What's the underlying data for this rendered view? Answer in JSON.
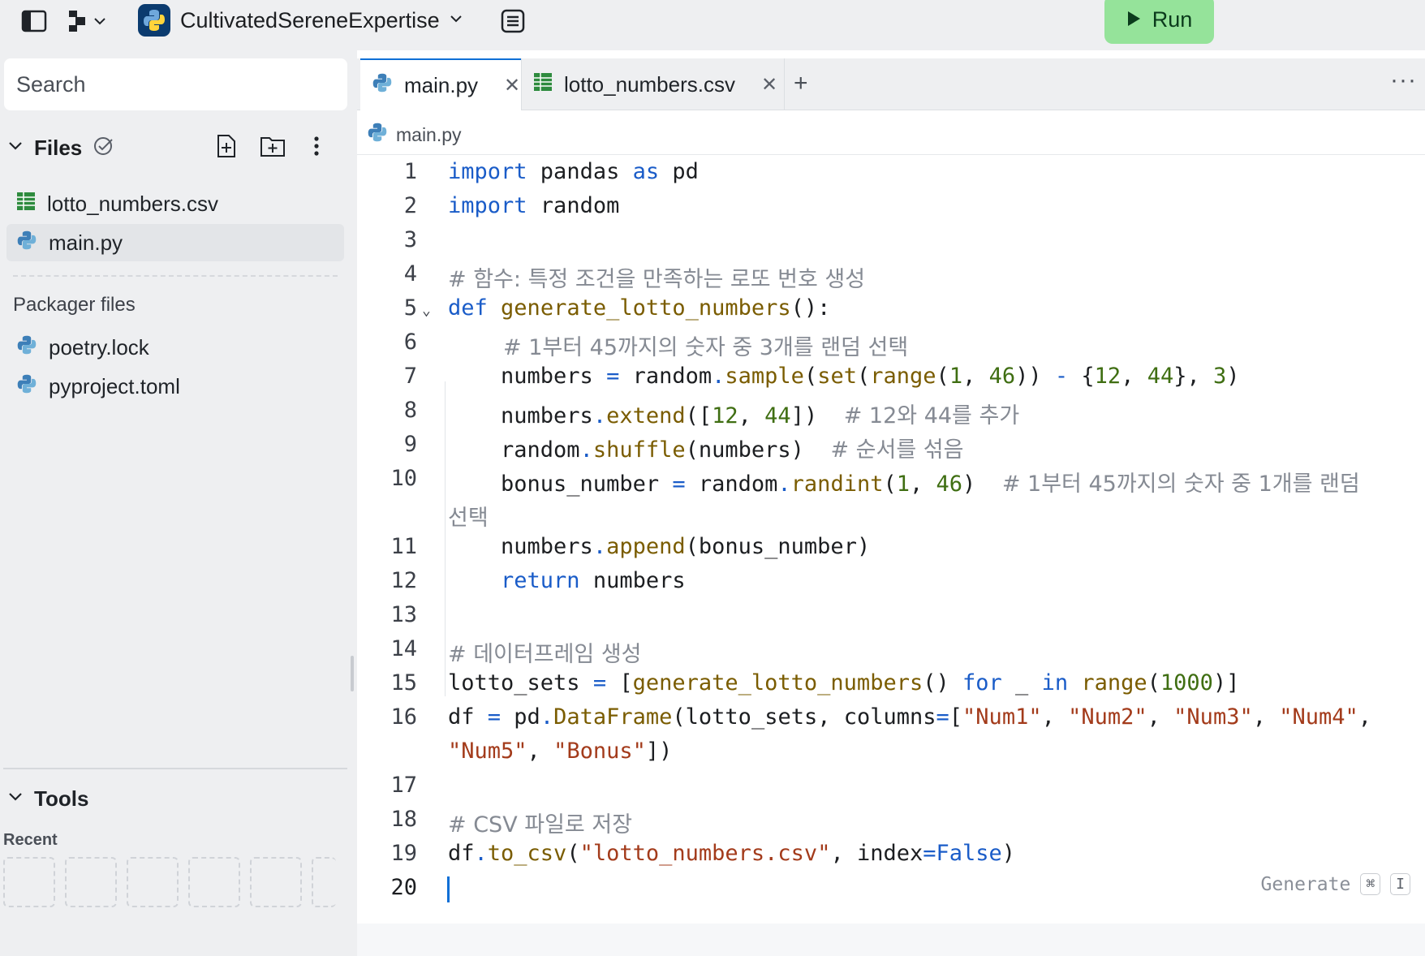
{
  "topbar": {
    "project_name": "CultivatedSereneExpertise",
    "run_label": "Run",
    "icons": [
      "sidebar-toggle-icon",
      "workspace-switch-icon",
      "python-logo-icon",
      "chevron-down-icon",
      "layout-icon",
      "play-icon"
    ]
  },
  "sidebar": {
    "search_placeholder": "Search",
    "files_title": "Files",
    "files": [
      {
        "name": "lotto_numbers.csv",
        "icon": "csv-file-icon"
      },
      {
        "name": "main.py",
        "icon": "python-file-icon"
      }
    ],
    "packager_label": "Packager files",
    "packager_files": [
      {
        "name": "poetry.lock",
        "icon": "python-file-icon"
      },
      {
        "name": "pyproject.toml",
        "icon": "python-file-icon"
      }
    ],
    "tools_title": "Tools",
    "recent_label": "Recent"
  },
  "editor": {
    "tabs": [
      {
        "label": "main.py",
        "active": true
      },
      {
        "label": "lotto_numbers.csv",
        "active": false
      }
    ],
    "breadcrumb": "main.py",
    "generate_hint": "Generate",
    "shortcut_keys": [
      "⌘",
      "I"
    ],
    "line_numbers": [
      "1",
      "2",
      "3",
      "4",
      "5",
      "6",
      "7",
      "8",
      "9",
      "10",
      "11",
      "12",
      "13",
      "14",
      "15",
      "16",
      "17",
      "18",
      "19",
      "20"
    ],
    "comments": {
      "line4": "# 함수: 특정 조건을 만족하는 로또 번호 생성",
      "line6": "# 1부터 45까지의 숫자 중 3개를 랜덤 선택",
      "line8": "# 12와 44를 추가",
      "line9": "# 순서를 섞음",
      "line10": "# 1부터 45까지의 숫자 중 1개를 랜덤",
      "line10_wrap": "선택",
      "line14": "# 데이터프레임 생성",
      "line18": "# CSV 파일로 저장"
    }
  }
}
